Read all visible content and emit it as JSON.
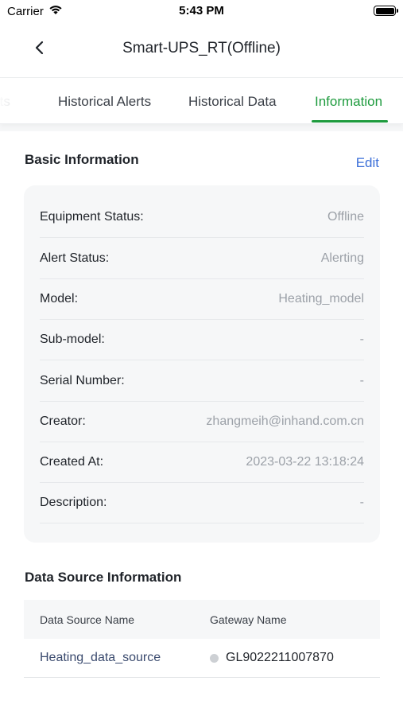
{
  "status_bar": {
    "carrier": "Carrier",
    "time": "5:43 PM"
  },
  "nav": {
    "title": "Smart-UPS_RT(Offline)"
  },
  "tabs": [
    {
      "label": "rts"
    },
    {
      "label": "Historical Alerts"
    },
    {
      "label": "Historical Data"
    },
    {
      "label": "Information",
      "active": true
    }
  ],
  "basic_info": {
    "title": "Basic Information",
    "edit_label": "Edit",
    "rows": [
      {
        "label": "Equipment Status:",
        "value": "Offline"
      },
      {
        "label": "Alert Status:",
        "value": "Alerting"
      },
      {
        "label": "Model:",
        "value": "Heating_model"
      },
      {
        "label": "Sub-model:",
        "value": "-"
      },
      {
        "label": "Serial Number:",
        "value": "-"
      },
      {
        "label": "Creator:",
        "value": "zhangmeih@inhand.com.cn"
      },
      {
        "label": "Created At:",
        "value": "2023-03-22 13:18:24"
      },
      {
        "label": "Description:",
        "value": "-"
      }
    ]
  },
  "data_source": {
    "title": "Data Source Information",
    "columns": [
      "Data Source Name",
      "Gateway Name"
    ],
    "rows": [
      {
        "name": "Heating_data_source",
        "gateway": "GL9022211007870"
      }
    ]
  },
  "colors": {
    "accent": "#1e9b3e",
    "link": "#3b6fd8",
    "gateway_status_dot": "#cdd0d4"
  },
  "icons": {
    "back": "chevron-left-icon",
    "wifi": "wifi-icon",
    "battery": "battery-icon"
  }
}
